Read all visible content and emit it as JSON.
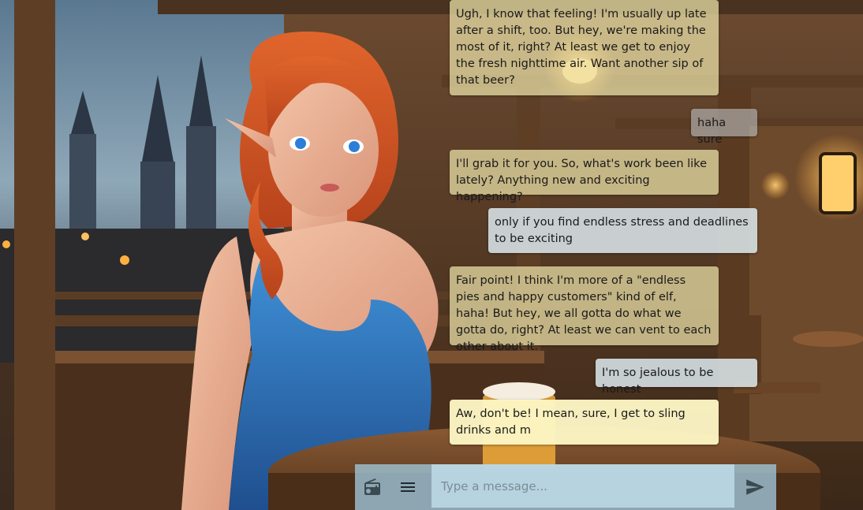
{
  "messages": [
    {
      "role": "bot",
      "text": "Ugh, I know that feeling! I'm usually up late after a shift, too. But hey, we're making the most of it, right? At least we get to enjoy the fresh nighttime air. Want another sip of that beer?"
    },
    {
      "role": "user",
      "text": "haha sure"
    },
    {
      "role": "bot",
      "text": "I'll grab it for you. So, what's work been like lately? Anything new and exciting happening?"
    },
    {
      "role": "user",
      "text": "only if you find endless stress and deadlines to be exciting"
    },
    {
      "role": "bot",
      "text": "Fair point! I think I'm more of a \"endless pies and happy customers\" kind of elf, haha! But hey, we all gotta do what we gotta do, right? At least we can vent to each other about it."
    },
    {
      "role": "user",
      "text": "I'm so jealous to be honest"
    },
    {
      "role": "bot",
      "text": "Aw, don't be! I mean, sure, I get to sling drinks and m"
    }
  ],
  "composer": {
    "placeholder": "Type a message...",
    "value": ""
  },
  "icons": {
    "radio": "radio-icon",
    "menu": "menu-icon",
    "send": "send-icon"
  },
  "colors": {
    "bot_bubble": "#EEE4AA",
    "user_bubble": "#DCE8EE",
    "composer_bar": "#A0C8DC"
  }
}
